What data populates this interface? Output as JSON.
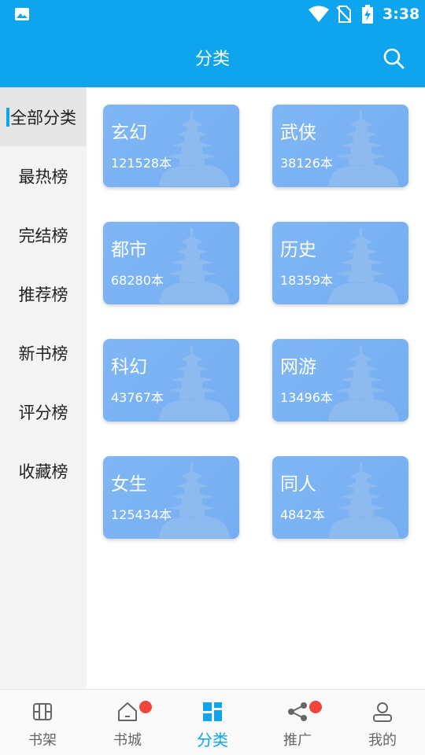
{
  "status_bar": {
    "time": "3:38"
  },
  "app_bar": {
    "title": "分类"
  },
  "sidebar": {
    "items": [
      {
        "label": "全部分类",
        "active": true
      },
      {
        "label": "最热榜",
        "active": false
      },
      {
        "label": "完结榜",
        "active": false
      },
      {
        "label": "推荐榜",
        "active": false
      },
      {
        "label": "新书榜",
        "active": false
      },
      {
        "label": "评分榜",
        "active": false
      },
      {
        "label": "收藏榜",
        "active": false
      }
    ]
  },
  "categories": [
    {
      "name": "玄幻",
      "count": "121528本"
    },
    {
      "name": "武侠",
      "count": "38126本"
    },
    {
      "name": "都市",
      "count": "68280本"
    },
    {
      "name": "历史",
      "count": "18359本"
    },
    {
      "name": "科幻",
      "count": "43767本"
    },
    {
      "name": "网游",
      "count": "13496本"
    },
    {
      "name": "女生",
      "count": "125434本"
    },
    {
      "name": "同人",
      "count": "4842本"
    }
  ],
  "bottom_nav": {
    "items": [
      {
        "label": "书架",
        "icon": "bookshelf-icon",
        "active": false,
        "badge": false
      },
      {
        "label": "书城",
        "icon": "home-icon",
        "active": false,
        "badge": true
      },
      {
        "label": "分类",
        "icon": "category-grid-icon",
        "active": true,
        "badge": false
      },
      {
        "label": "推广",
        "icon": "share-icon",
        "active": false,
        "badge": true
      },
      {
        "label": "我的",
        "icon": "user-icon",
        "active": false,
        "badge": false
      }
    ]
  },
  "colors": {
    "primary": "#0ea5ee",
    "card": "#7fb6f4",
    "badge": "#f0453a",
    "sidebar_bg": "#f4f4f4",
    "sidebar_active_bg": "#e6e6e6"
  }
}
